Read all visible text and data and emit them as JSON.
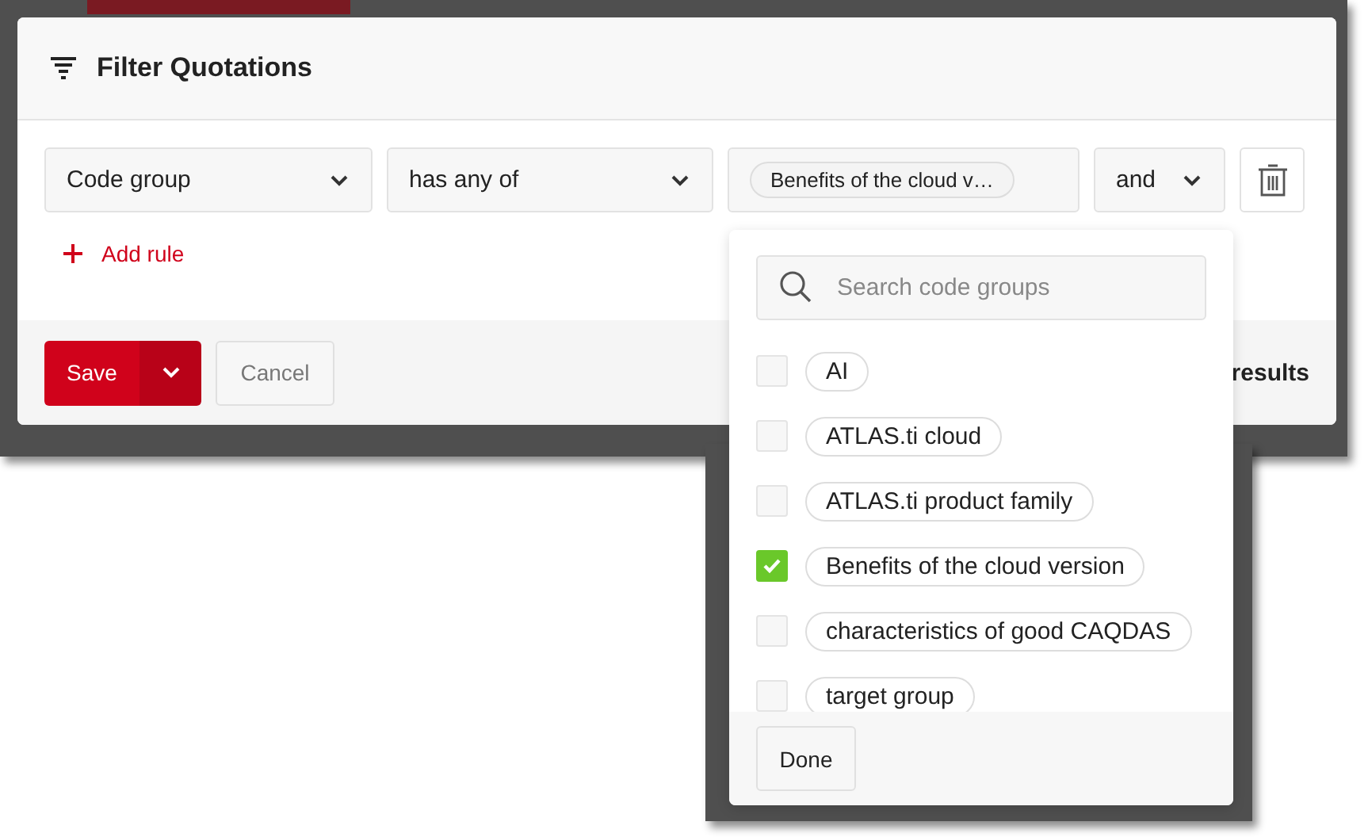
{
  "dialog": {
    "title": "Filter Quotations",
    "rule": {
      "field": "Code group",
      "operator": "has any of",
      "values": [
        "Benefits of the cloud v…"
      ],
      "conjunction": "and"
    },
    "add_rule": "Add rule",
    "footer": {
      "save": "Save",
      "cancel": "Cancel",
      "results": "results"
    }
  },
  "dropdown": {
    "search": {
      "placeholder": "Search code groups"
    },
    "items": [
      {
        "label": "AI",
        "checked": false
      },
      {
        "label": "ATLAS.ti cloud",
        "checked": false
      },
      {
        "label": "ATLAS.ti product family",
        "checked": false
      },
      {
        "label": "Benefits of the cloud version",
        "checked": true
      },
      {
        "label": "characteristics of good CAQDAS",
        "checked": false
      },
      {
        "label": "target group",
        "checked": false
      }
    ],
    "done": "Done"
  }
}
